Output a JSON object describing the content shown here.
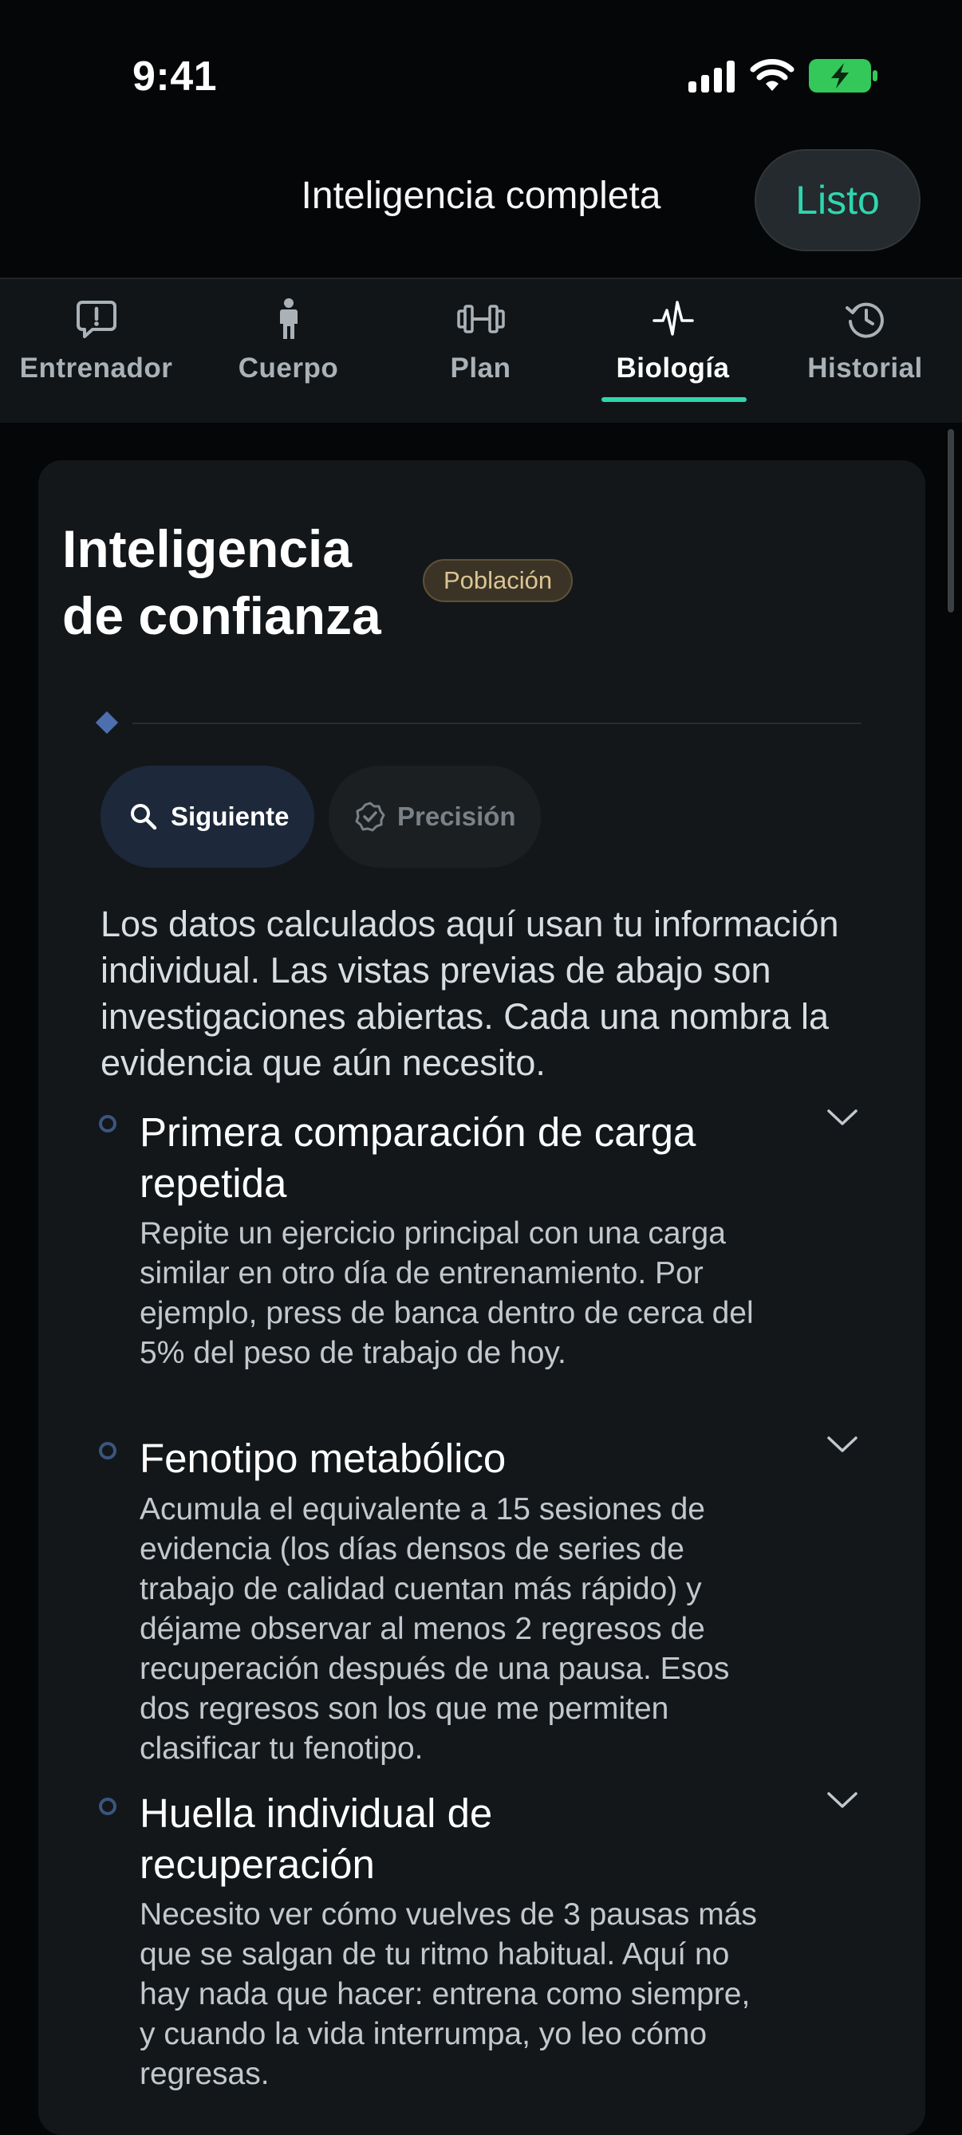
{
  "status_bar": {
    "time": "9:41"
  },
  "header": {
    "title": "Inteligencia completa",
    "done_label": "Listo"
  },
  "tabs": [
    {
      "label": "Entrenador",
      "icon": "chat-alert-icon"
    },
    {
      "label": "Cuerpo",
      "icon": "person-icon"
    },
    {
      "label": "Plan",
      "icon": "dumbbell-icon"
    },
    {
      "label": "Biología",
      "icon": "heartbeat-icon",
      "active": true
    },
    {
      "label": "Historial",
      "icon": "history-icon"
    }
  ],
  "card": {
    "title_line1": "Inteligencia",
    "title_line2": "de confianza",
    "badge": "Población",
    "pills": {
      "next_label": "Siguiente",
      "precision_label": "Precisión"
    },
    "intro": "Los datos calculados aquí usan tu información individual. Las vistas previas de abajo son investigaciones abiertas. Cada una nombra la evidencia que aún necesito.",
    "items": [
      {
        "title": "Primera comparación de carga repetida",
        "body": "Repite un ejercicio principal con una carga similar en otro día de entrenamiento. Por ejemplo, press de banca dentro de cerca del 5% del peso de trabajo de hoy."
      },
      {
        "title": "Fenotipo metabólico",
        "body": "Acumula el equivalente a 15 sesiones de evidencia (los días densos de series de trabajo de calidad cuentan más rápido) y déjame observar al menos 2 regresos de recuperación después de una pausa. Esos dos regresos son los que me permiten clasificar tu fenotipo."
      },
      {
        "title": "Huella individual de recuperación",
        "body": "Necesito ver cómo vuelves de 3 pausas más que se salgan de tu ritmo habitual. Aquí no hay nada que hacer: entrena como siempre, y cuando la vida interrumpa, yo leo cómo regresas."
      }
    ]
  },
  "colors": {
    "accent": "#2fd6b0",
    "background": "#050607",
    "card": "#13171a",
    "badge_text": "#dcc594"
  }
}
